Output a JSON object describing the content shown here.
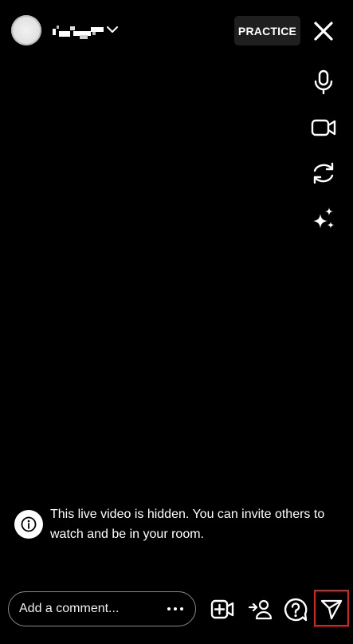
{
  "header": {
    "practice_label": "PRACTICE"
  },
  "side_controls": [
    {
      "name": "microphone-icon"
    },
    {
      "name": "video-camera-icon"
    },
    {
      "name": "flip-camera-icon"
    },
    {
      "name": "effects-sparkle-icon"
    }
  ],
  "notice": {
    "text": "This live video is hidden. You can invite others to watch and be in your room."
  },
  "comment": {
    "placeholder": "Add a comment..."
  },
  "bottom_bar": {
    "icons": [
      "add-video-icon",
      "invite-person-icon",
      "question-icon",
      "send-icon"
    ]
  },
  "colors": {
    "background": "#000000",
    "button_bg": "#1f1f1f",
    "highlight_border": "#e02020"
  }
}
